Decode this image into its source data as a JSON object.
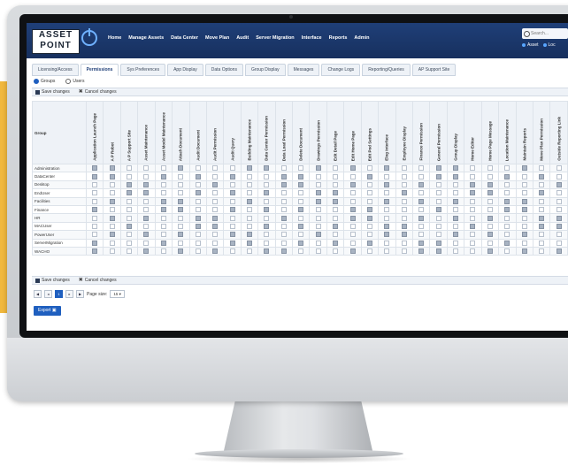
{
  "logo": {
    "line1": "ASSET",
    "line2": "POINT"
  },
  "nav": {
    "items": [
      "Home",
      "Manage Assets",
      "Data Center",
      "Move Plan",
      "Audit",
      "Server Migration",
      "Interface",
      "Reports",
      "Admin"
    ]
  },
  "search": {
    "placeholder": "Search..."
  },
  "asset_toggle": {
    "left": "Asset",
    "right": "Loc"
  },
  "tabs": [
    "Licensing/Access",
    "Permissions",
    "Sys Preferences",
    "App Display",
    "Data Options",
    "Group Display",
    "Messages",
    "Change Logs",
    "Reporting/Queries",
    "AP Support Site"
  ],
  "radios": {
    "groups": "Groups",
    "users": "Users"
  },
  "actions": {
    "save": "Save changes",
    "cancel": "Cancel changes"
  },
  "grid": {
    "group_header": "Group",
    "permissions": [
      "Application Launch Page",
      "A P Robot",
      "A P Support Site",
      "Asset Maintenance",
      "Asset Model Maintenance",
      "Attach Document",
      "Audit Document",
      "Audit Permission",
      "Audit Query",
      "Building Maintenance",
      "Data Center Permission",
      "Data Load Permission",
      "Delete Document",
      "Drawings Permission",
      "Edit Detail Page",
      "Edit Home Page",
      "Edit Pod Settings",
      "Elog Interface",
      "Employee Display",
      "Finance Permission",
      "General Permission",
      "Group Display",
      "Home Editor",
      "Home Page Message",
      "Location Maintenance",
      "Maintain Reports",
      "Move Plan Permission",
      "Outside Reporting Link"
    ],
    "groups": [
      "Administration",
      "DataCenter",
      "Desktop",
      "EndUser",
      "Facilities",
      "Finance",
      "HR",
      "MACUser",
      "PowerUser",
      "ServerMigration",
      "WACHO"
    ]
  },
  "pager": {
    "label": "Page size:",
    "size": "15",
    "current": "1"
  },
  "export": {
    "label": "Export"
  }
}
